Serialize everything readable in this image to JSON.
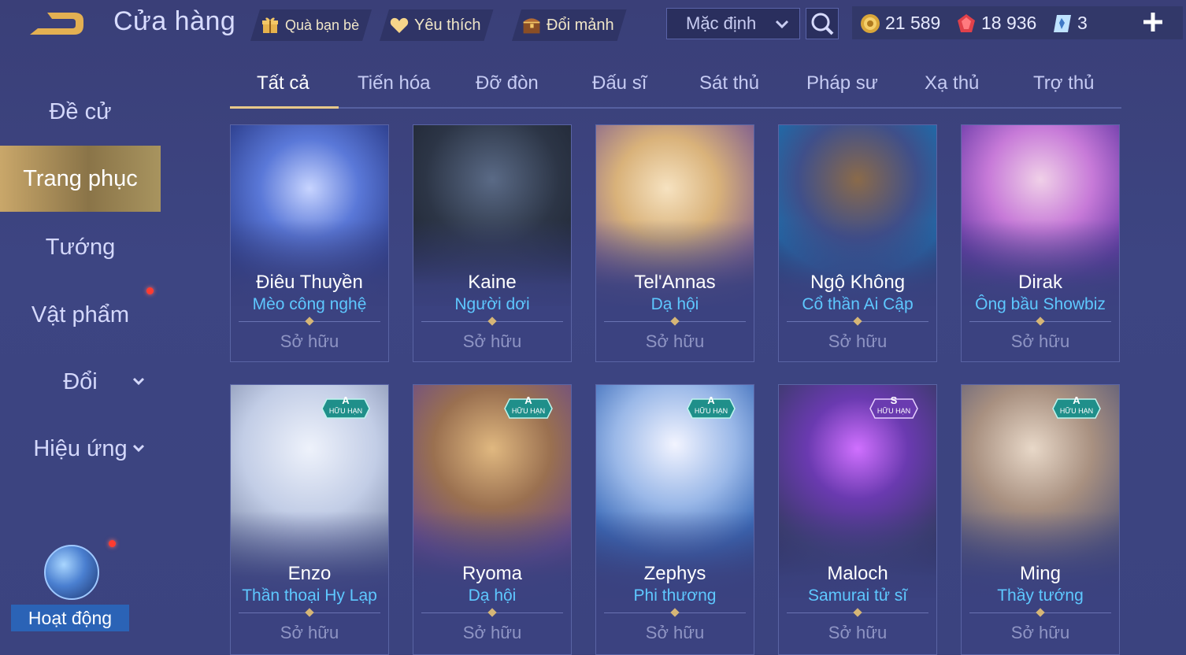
{
  "header": {
    "title": "Cửa hàng",
    "gift_label": "Quà bạn bè",
    "favorite_label": "Yêu thích",
    "exchange_label": "Đổi mảnh",
    "sort_value": "Mặc định",
    "currency": {
      "gold": "21 589",
      "voucher": "18 936",
      "gems": "3"
    }
  },
  "sidebar": {
    "items": [
      {
        "label": "Đề cử"
      },
      {
        "label": "Trang phục"
      },
      {
        "label": "Tướng"
      },
      {
        "label": "Vật phẩm"
      },
      {
        "label": "Đổi"
      },
      {
        "label": "Hiệu ứng"
      }
    ],
    "activity_label": "Hoạt động"
  },
  "tabs": [
    "Tất cả",
    "Tiến hóa",
    "Đỡ đòn",
    "Đấu sĩ",
    "Sát thủ",
    "Pháp sư",
    "Xạ thủ",
    "Trợ thủ"
  ],
  "cards": [
    {
      "hero": "Điêu Thuyền",
      "skin": "Mèo công nghệ",
      "status": "Sở hữu"
    },
    {
      "hero": "Kaine",
      "skin": "Người dơi",
      "status": "Sở hữu"
    },
    {
      "hero": "Tel'Annas",
      "skin": "Dạ hội",
      "status": "Sở hữu"
    },
    {
      "hero": "Ngộ Không",
      "skin": "Cổ thần Ai Cập",
      "status": "Sở hữu"
    },
    {
      "hero": "Dirak",
      "skin": "Ông bầu Showbiz",
      "status": "Sở hữu"
    },
    {
      "hero": "Enzo",
      "skin": "Thần thoại Hy Lạp",
      "status": "Sở hữu",
      "badge_grade": "A",
      "badge_text": "HỮU HẠN"
    },
    {
      "hero": "Ryoma",
      "skin": "Dạ hội",
      "status": "Sở hữu",
      "badge_grade": "A",
      "badge_text": "HỮU HẠN"
    },
    {
      "hero": "Zephys",
      "skin": "Phi thương",
      "status": "Sở hữu",
      "badge_grade": "A",
      "badge_text": "HỮU HẠN"
    },
    {
      "hero": "Maloch",
      "skin": "Samurai tử sĩ",
      "status": "Sở hữu",
      "badge_grade": "S",
      "badge_text": "HỮU HẠN"
    },
    {
      "hero": "Ming",
      "skin": "Thầy tướng",
      "status": "Sở hữu",
      "badge_grade": "A",
      "badge_text": "HỮU HẠN"
    }
  ],
  "colors": {
    "background": "#3d4582",
    "active_nav_gold": "#c9a76a",
    "skin_name_blue": "#5ec8ff",
    "badge_a": "#1f8f8a",
    "badge_s": "#6a3bb0"
  },
  "icons": [
    "back-arrow-icon",
    "gift-icon",
    "heart-icon",
    "chest-icon",
    "chevron-down-icon",
    "search-icon",
    "gold-coin-icon",
    "voucher-gem-icon",
    "diamond-card-icon",
    "plus-icon"
  ]
}
